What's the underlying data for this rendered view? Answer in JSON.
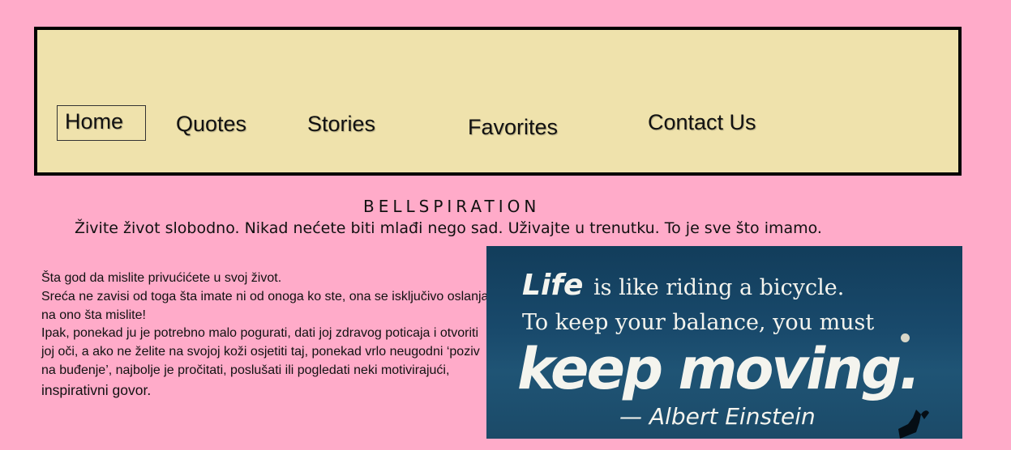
{
  "nav": {
    "items": [
      {
        "label": "Home"
      },
      {
        "label": "Quotes"
      },
      {
        "label": "Stories"
      },
      {
        "label": "Favorites"
      },
      {
        "label": "Contact Us"
      }
    ]
  },
  "brand": "BELLSPIRATION",
  "tagline": "Živite život slobodno. Nikad nećete biti mlađi nego sad. Uživajte u trenutku. To je sve što imamo.",
  "body": {
    "lines": [
      "Šta god da mislite privućićete u svoj život.",
      "Sreća ne zavisi od toga šta imate ni od onoga ko ste, ona se isključivo oslanja na ono šta mislite!",
      "Ipak, ponekad ju je potrebno malo pogurati, dati joj zdravog poticaja i otvoriti joj oči, a ako ne želite na svojoj koži osjetiti taj, ponekad vrlo neugodni ‘poziv na buđenje’, najbolje je pročitati, poslušati ili pogledati neki motivirajući,",
      "inspirativni govor."
    ]
  },
  "quote_image": {
    "word1": "Life",
    "line1": "is like riding a bicycle.",
    "line2": "To keep your balance, you must",
    "line3": "keep moving.",
    "author": "— Albert Einstein"
  }
}
